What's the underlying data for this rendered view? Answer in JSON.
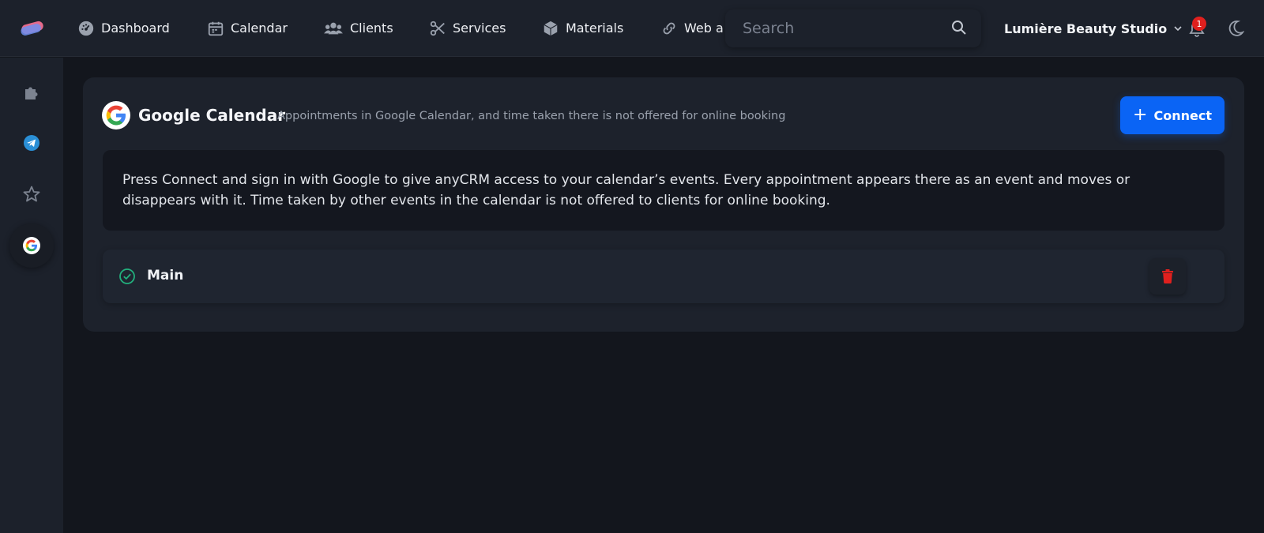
{
  "nav": {
    "items": [
      {
        "label": "Dashboard",
        "icon": "dashboard-gauge-icon"
      },
      {
        "label": "Calendar",
        "icon": "calendar-icon"
      },
      {
        "label": "Clients",
        "icon": "users-icon"
      },
      {
        "label": "Services",
        "icon": "scissors-icon"
      },
      {
        "label": "Materials",
        "icon": "box-icon"
      },
      {
        "label": "Web a",
        "icon": "link-icon"
      }
    ]
  },
  "search": {
    "placeholder": "Search"
  },
  "studio": {
    "name": "Lumière Beauty Studio"
  },
  "notifications": {
    "count": "1"
  },
  "sidebar": {
    "items": [
      {
        "icon": "puzzle-icon"
      },
      {
        "icon": "telegram-icon"
      },
      {
        "icon": "star-icon"
      },
      {
        "icon": "google-icon",
        "active": true
      }
    ]
  },
  "integration": {
    "title": "Google Calendar",
    "subtitle": "Appointments in Google Calendar, and time taken there is not offered for online booking",
    "connect_label": "Connect",
    "description": "Press Connect and sign in with Google to give anyCRM access to your calendar’s events. Every appointment appears there as an event and moves or disappears with it. Time taken by other events in the calendar is not offered to clients for online booking.",
    "accounts": [
      {
        "name": "Main",
        "status": "connected"
      }
    ]
  },
  "colors": {
    "accent": "#0a64f5",
    "success": "#22b07d",
    "danger": "#e0201e"
  }
}
